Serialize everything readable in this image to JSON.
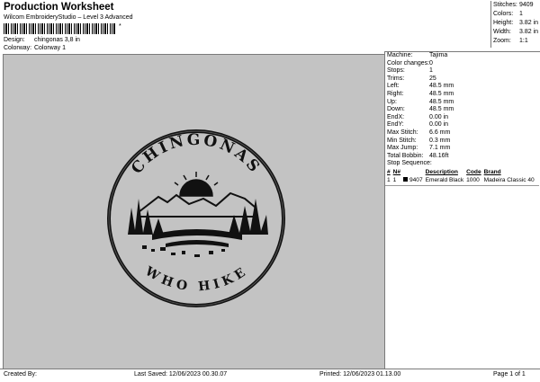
{
  "header": {
    "title": "Production Worksheet",
    "subtitle": "Wilcom EmbroideryStudio – Level 3 Advanced",
    "barcode_text": "*",
    "design_label": "Design:",
    "design_value": "chingonas 3,8 in",
    "colorway_label": "Colorway:",
    "colorway_value": "Colorway 1"
  },
  "summary": [
    {
      "label": "Stitches:",
      "value": "9409"
    },
    {
      "label": "Colors:",
      "value": "1"
    },
    {
      "label": "Height:",
      "value": "3.82 in"
    },
    {
      "label": "Width:",
      "value": "3.82 in"
    },
    {
      "label": "Zoom:",
      "value": "1:1"
    }
  ],
  "machine_info": [
    {
      "label": "Machine:",
      "value": "Tajima"
    },
    {
      "label": "Color changes:",
      "value": "0"
    },
    {
      "label": "Stops:",
      "value": "1"
    },
    {
      "label": "Trims:",
      "value": "25"
    },
    {
      "label": "Left:",
      "value": "48.5 mm"
    },
    {
      "label": "Right:",
      "value": "48.5 mm"
    },
    {
      "label": "Up:",
      "value": "48.5 mm"
    },
    {
      "label": "Down:",
      "value": "48.5 mm"
    },
    {
      "label": "EndX:",
      "value": "0.00 in"
    },
    {
      "label": "EndY:",
      "value": "0.00 in"
    },
    {
      "label": "Max Stitch:",
      "value": "6.6 mm"
    },
    {
      "label": "Min Stitch:",
      "value": "0.3 mm"
    },
    {
      "label": "Max Jump:",
      "value": "7.1 mm"
    },
    {
      "label": "Total Bobbin:",
      "value": "48.16ft"
    }
  ],
  "stop_sequence": {
    "title": "Stop Sequence:",
    "columns": [
      "#",
      "N#",
      "Description",
      "Code",
      "Brand"
    ],
    "rows": [
      {
        "num": "1",
        "n": "1",
        "stitches": "9407",
        "description": "Emerald Black",
        "code": "1000",
        "brand": "Madeira Classic 40",
        "color": "#000000"
      }
    ]
  },
  "design_art": {
    "top_text": "CHINGONAS",
    "bottom_text": "WHO HIKE"
  },
  "footer": {
    "created_by": "Created By:",
    "last_saved": "Last Saved: 12/06/2023 00.30.07",
    "printed": "Printed: 12/06/2023 01.13.00",
    "page": "Page 1 of 1"
  }
}
